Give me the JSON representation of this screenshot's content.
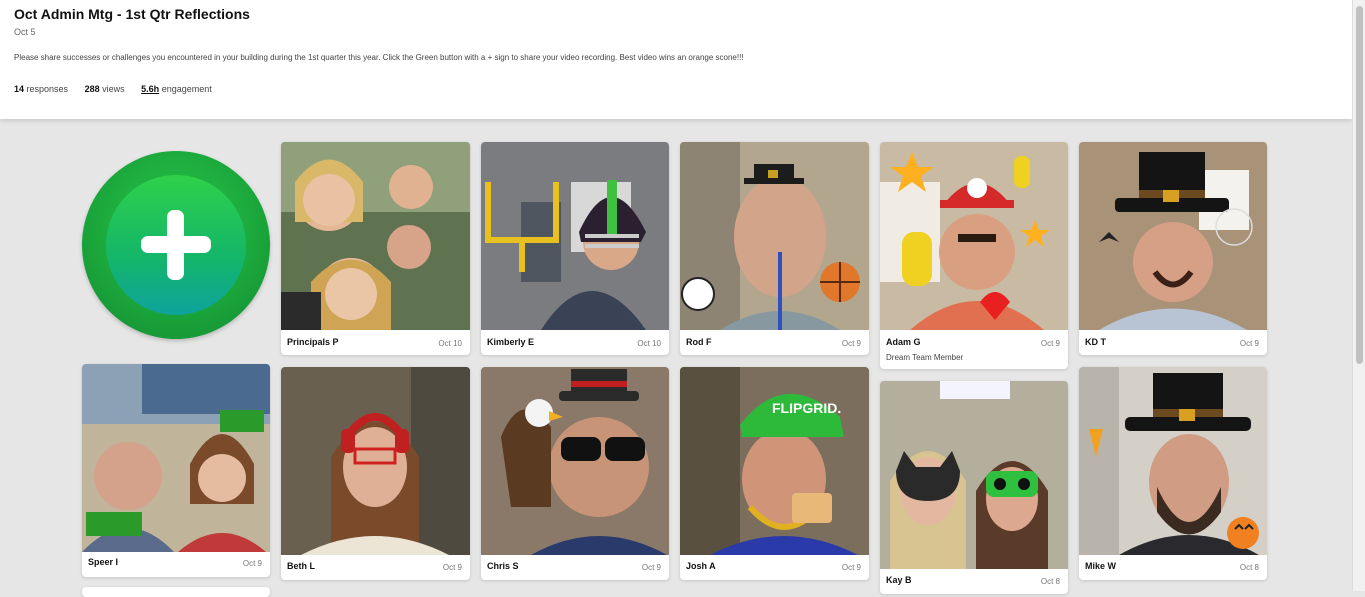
{
  "header": {
    "title": "Oct Admin Mtg - 1st Qtr Reflections",
    "date": "Oct 5",
    "description": "Please share successes or challenges you encountered in your building during the 1st quarter this year.  Click the Green button with a + sign to share your video recording.  Best video wins an orange scone!!!",
    "stats": {
      "responses_count": "14",
      "responses_label": "responses",
      "views_count": "288",
      "views_label": "views",
      "engagement_count": "5.6h",
      "engagement_label": "engagement"
    }
  },
  "add_button": {
    "icon": "plus-icon",
    "color": "#1aa43a"
  },
  "responses": [
    {
      "name": "Principals P",
      "date": "Oct 10",
      "bg": "#6a7a5a",
      "sticker": ""
    },
    {
      "name": "Kimberly E",
      "date": "Oct 10",
      "bg": "#7d7e85",
      "sticker": "football-helmet"
    },
    {
      "name": "Rod F",
      "date": "Oct 9",
      "bg": "#b8a88c",
      "sticker": "pilgrim-hat"
    },
    {
      "name": "Adam G",
      "date": "Oct 9",
      "subtitle": "Dream Team Member",
      "bg": "#c8b8a0",
      "sticker": "mario-cap"
    },
    {
      "name": "KD T",
      "date": "Oct 9",
      "bg": "#b09c80",
      "sticker": "pilgrim-hat"
    },
    {
      "name": "Speer I",
      "date": "Oct 9",
      "bg": "#8aa0b8",
      "sticker": "bow-tie"
    },
    {
      "name": "Beth L",
      "date": "Oct 9",
      "bg": "#6e6456",
      "sticker": "headphones"
    },
    {
      "name": "Chris S",
      "date": "Oct 9",
      "bg": "#9a7a6a",
      "sticker": "top-hat"
    },
    {
      "name": "Josh A",
      "date": "Oct 9",
      "bg": "#7a6a5a",
      "sticker": "flipgrid-cap",
      "sticker_text": "FLIPGRID."
    },
    {
      "name": "Kay B",
      "date": "Oct 8",
      "bg": "#b8b2a0",
      "sticker": "cat-mask"
    },
    {
      "name": "Mike W",
      "date": "Oct 8",
      "bg": "#d8d4cc",
      "sticker": "pilgrim-hat"
    }
  ]
}
